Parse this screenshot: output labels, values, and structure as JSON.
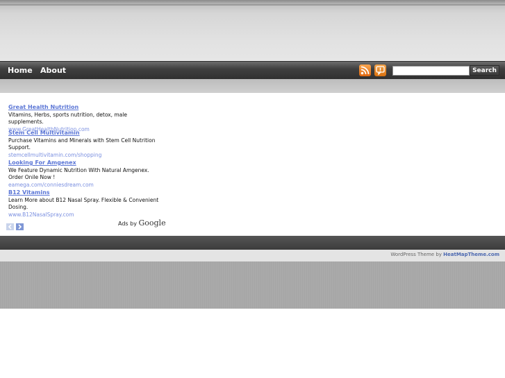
{
  "nav": {
    "items": [
      {
        "label": "Home"
      },
      {
        "label": "About"
      }
    ],
    "search": {
      "value": "",
      "button_label": "Search"
    },
    "icons": [
      "rss-icon",
      "comment-icon"
    ]
  },
  "ads": [
    {
      "title": "Great Health Nutrition",
      "desc": "Vitamins, Herbs, sports nutrition, detox, male supplements.",
      "url": "www.GreatHealthNutrition.com"
    },
    {
      "title": "Stem Cell Multivitamin",
      "desc": "Purchase Vitamins and Minerals with Stem Cell Nutrition Support.",
      "url": "stemcellmultivitamin.com/shopping"
    },
    {
      "title": "Looking For Amgenex",
      "desc": "We Feature Dynamic Nutrition With Natural Amgenex. Order Onile Now !",
      "url": "eamega.com/conniesdream.com"
    },
    {
      "title": "B12 Vitamins",
      "desc": "Learn More about B12 Nasal Spray. Flexible & Convenient Dosing.",
      "url": "www.B12NasalSpray.com"
    }
  ],
  "ads_by": {
    "label": "Ads by",
    "brand": "Google"
  },
  "footer": {
    "credit_prefix": "WordPress Theme by",
    "credit_link": "HeatMapTheme.com"
  },
  "colors": {
    "ad_link": "#5b76d6",
    "nav_bg": "#3f3f3f",
    "rss": "#e0670f"
  }
}
